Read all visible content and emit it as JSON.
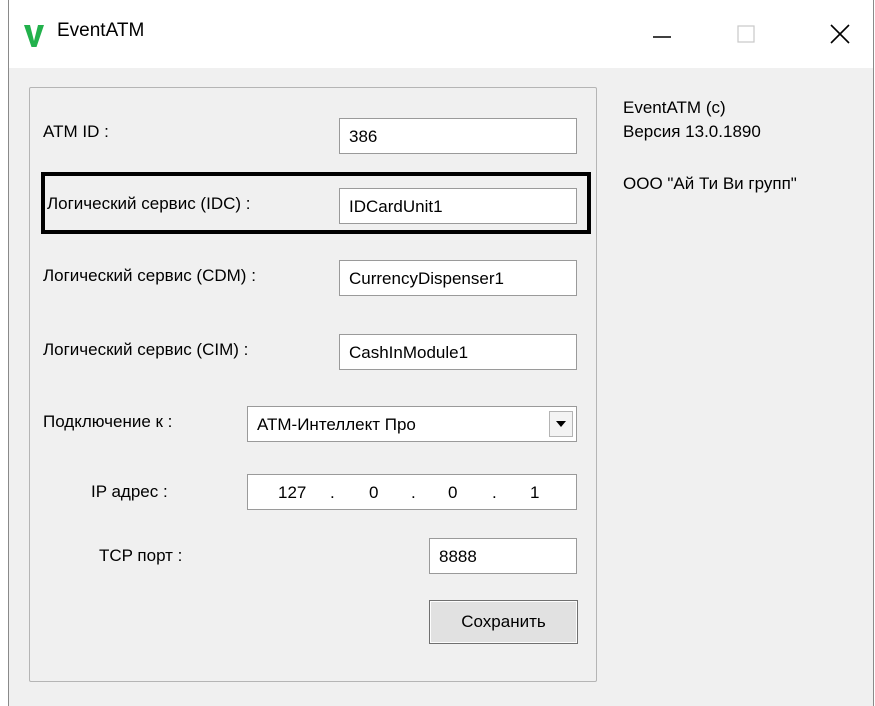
{
  "window": {
    "title": "EventATM",
    "icon": "v-logo-icon",
    "accent_color": "#22b14c"
  },
  "form": {
    "atm_id": {
      "label": "ATM ID :",
      "value": "386"
    },
    "idc": {
      "label": "Логический сервис (IDC) :",
      "value": "IDCardUnit1"
    },
    "cdm": {
      "label": "Логический сервис (CDM) :",
      "value": "CurrencyDispenser1"
    },
    "cim": {
      "label": "Логический сервис (CIM) :",
      "value": "CashInModule1"
    },
    "connect": {
      "label": "Подключение к :",
      "selected": "АТМ-Интеллект Про"
    },
    "ip": {
      "label": "IP адрес :",
      "octets": [
        "127",
        "0",
        "0",
        "1"
      ],
      "separator": "."
    },
    "tcp": {
      "label": "TCP порт :",
      "value": "8888"
    },
    "save_label": "Сохранить"
  },
  "info": {
    "line1": "EventATM (c)",
    "line2": "Версия 13.0.1890",
    "line3": "ООО \"Ай Ти Ви групп\""
  }
}
